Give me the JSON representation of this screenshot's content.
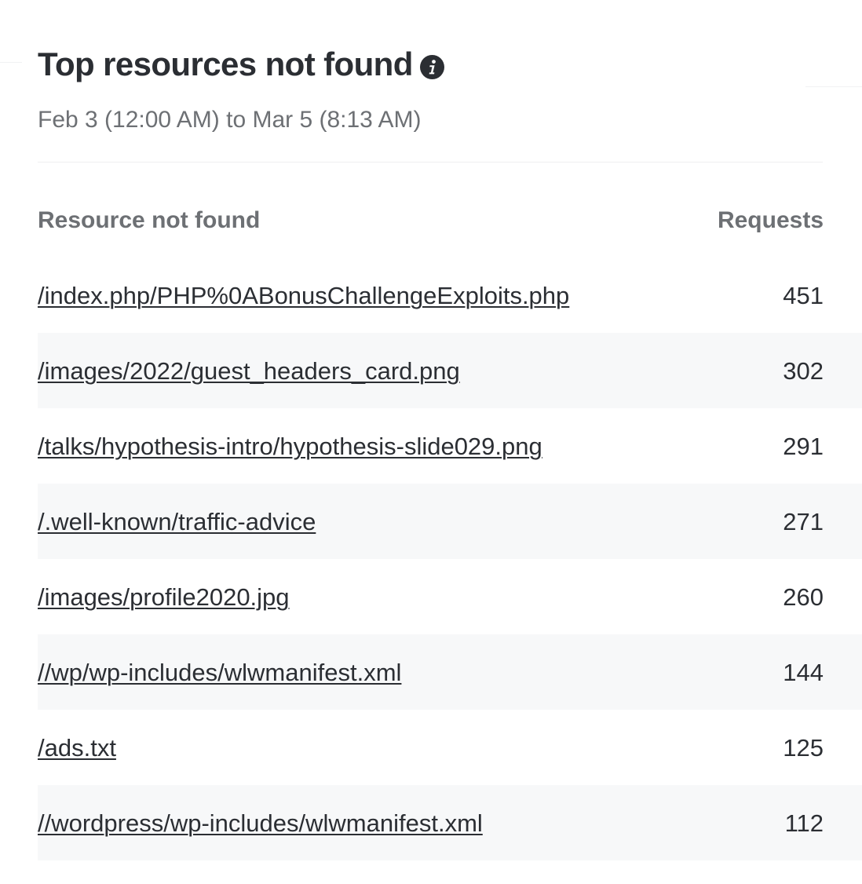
{
  "panel": {
    "title": "Top resources not found",
    "info_icon": "info-icon",
    "date_range": "Feb 3 (12:00 AM) to Mar 5 (8:13 AM)"
  },
  "table": {
    "columns": [
      "Resource not found",
      "Requests"
    ],
    "rows": [
      {
        "resource": "/index.php/PHP%0ABonusChallengeExploits.php",
        "requests": "451"
      },
      {
        "resource": "/images/2022/guest_headers_card.png",
        "requests": "302"
      },
      {
        "resource": "/talks/hypothesis-intro/hypothesis-slide029.png",
        "requests": "291"
      },
      {
        "resource": "/.well-known/traffic-advice",
        "requests": "271"
      },
      {
        "resource": "/images/profile2020.jpg",
        "requests": "260"
      },
      {
        "resource": "//wp/wp-includes/wlwmanifest.xml",
        "requests": "144"
      },
      {
        "resource": "/ads.txt",
        "requests": "125"
      },
      {
        "resource": "//wordpress/wp-includes/wlwmanifest.xml",
        "requests": "112"
      }
    ]
  },
  "colors": {
    "text": "#2b2e33",
    "muted": "#6d7074",
    "row_alt_bg": "#f7f8f9"
  }
}
